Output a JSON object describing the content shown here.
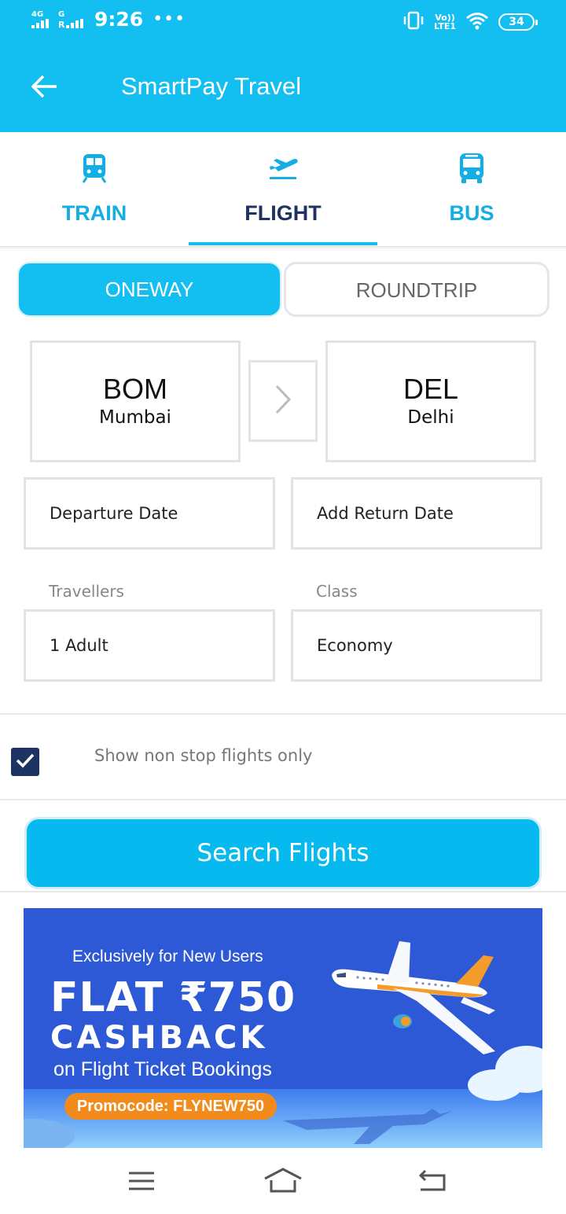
{
  "status_bar": {
    "network_left": "4G",
    "network_right": "G",
    "time": "9:26",
    "more": "•••",
    "lte_top": "Vo))",
    "lte_bottom": "LTE1",
    "battery": "34"
  },
  "app_bar": {
    "title": "SmartPay Travel",
    "back_icon": "arrow-left-icon"
  },
  "tabs": [
    {
      "label": "TRAIN",
      "icon": "train-icon",
      "active": false
    },
    {
      "label": "FLIGHT",
      "icon": "flight-takeoff-icon",
      "active": true
    },
    {
      "label": "BUS",
      "icon": "bus-icon",
      "active": false
    }
  ],
  "trip_type": {
    "oneway": "ONEWAY",
    "roundtrip": "ROUNDTRIP",
    "selected": "ONEWAY"
  },
  "route": {
    "from": {
      "code": "BOM",
      "city": "Mumbai"
    },
    "to": {
      "code": "DEL",
      "city": "Delhi"
    },
    "swap_icon": "chevron-right-icon"
  },
  "dates": {
    "departure_placeholder": "Departure Date",
    "return_placeholder": "Add Return Date"
  },
  "travellers": {
    "label": "Travellers",
    "value": "1 Adult"
  },
  "class": {
    "label": "Class",
    "value": "Economy"
  },
  "non_stop": {
    "label": "Show non stop flights only",
    "checked": true
  },
  "search_button": "Search Flights",
  "banner": {
    "line1": "Exclusively for New Users",
    "line2": "FLAT ₹750",
    "line3": "CASHBACK",
    "line4": "on Flight Ticket Bookings",
    "promo": "Promocode: FLYNEW750"
  },
  "nav_bar": {
    "items": [
      "menu-icon",
      "home-icon",
      "back-icon"
    ]
  },
  "colors": {
    "primary": "#13bff0",
    "dark_navy": "#1d3463",
    "tab_label": "#13aee3",
    "banner_bg": "#2d59d6",
    "promo_orange": "#f38a1c"
  }
}
